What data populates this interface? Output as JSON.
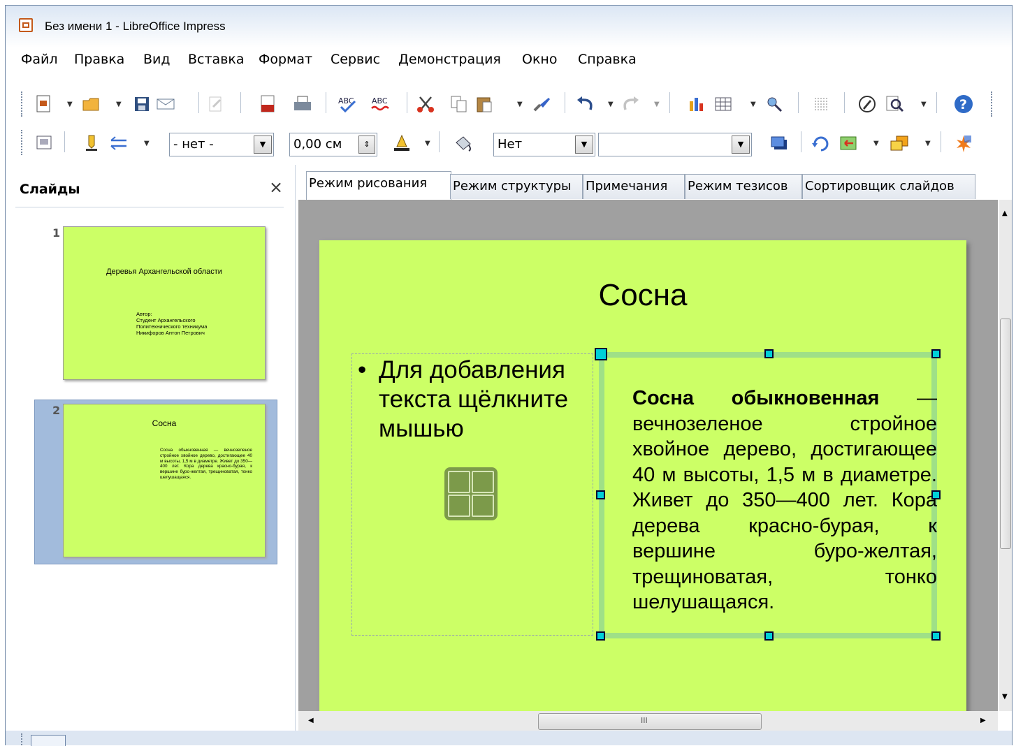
{
  "window": {
    "title": "Без имени 1 - LibreOffice Impress"
  },
  "menu": [
    "Файл",
    "Правка",
    "Вид",
    "Вставка",
    "Формат",
    "Сервис",
    "Демонстрация",
    "Окно",
    "Справка"
  ],
  "toolbar2": {
    "line_style": "- нет -",
    "line_width": "0,00 см",
    "area_style": "Нет",
    "area_fill": ""
  },
  "slides_pane": {
    "title": "Слайды",
    "close": "×",
    "slides": [
      {
        "number": "1",
        "title": "Деревья Архангельской области",
        "body": [
          "Автор:",
          "Студент Архангельского",
          "Политехнического техникума",
          "Никифоров Антон Петрович"
        ]
      },
      {
        "number": "2",
        "title": "Сосна",
        "body": "Сосна обыкновенная — вечнозеленое стройное хвойное дерево, достигающее 40 м высоты, 1,5 м в диаметре. Живет до 350—400 лет. Кора дерева красно-бурая, к вершине буро-желтая, трещиноватая, тонко шелушащаяся."
      }
    ]
  },
  "tabs": [
    "Режим рисования",
    "Режим структуры",
    "Примечания",
    "Режим тезисов",
    "Сортировщик слайдов"
  ],
  "active_tab": "Режим рисования",
  "slide": {
    "title": "Сосна",
    "placeholder_bullet": "•",
    "placeholder_text": "Для добавления текста щёлкните мышью",
    "text_bold": "Сосна обыкновенная",
    "text_rest": " — вечнозеленое стройное хвойное дерево, достигающее 40 м высоты, 1,5 м в диаметре. Живет до 350—400 лет. Кора дерева красно-бурая, к вершине буро-желтая, трещиноватая, тонко шелушащаяся.",
    "background_color": "#ccff66",
    "selection_color": "#9fe087",
    "handle_color": "#00d0d8"
  },
  "scrollbar": {
    "hthumb_grip": "III"
  }
}
